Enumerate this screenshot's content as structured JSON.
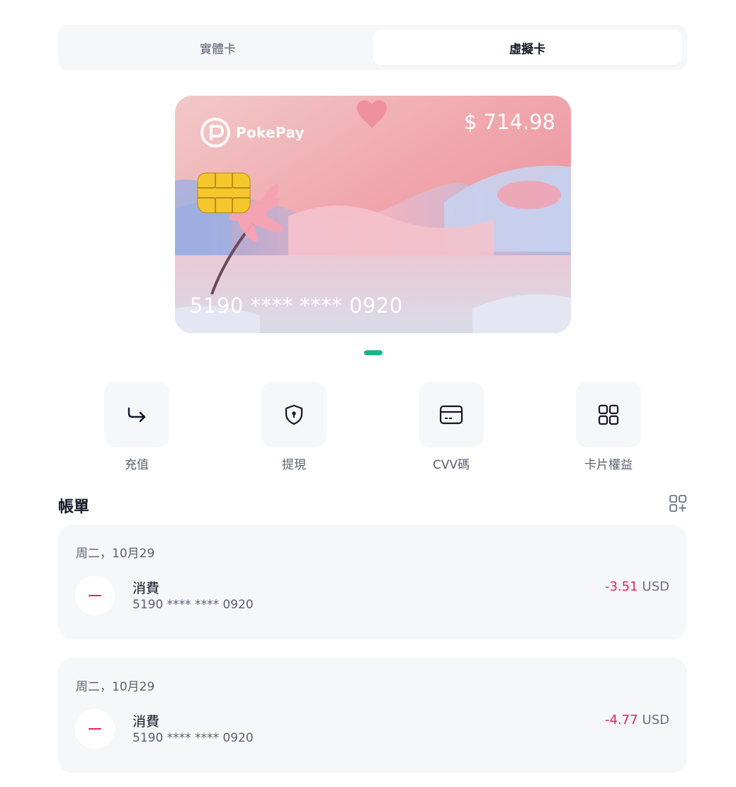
{
  "tabs": [
    {
      "label": "實體卡",
      "active": false
    },
    {
      "label": "虛擬卡",
      "active": true
    }
  ],
  "card": {
    "brand": "PokePay",
    "balance": "$ 714.98",
    "number": "5190 **** **** 0920"
  },
  "actions": [
    {
      "label": "充值",
      "icon": "redirect-arrow-icon"
    },
    {
      "label": "提現",
      "icon": "shield-keyhole-icon"
    },
    {
      "label": "CVV碼",
      "icon": "credit-card-icon"
    },
    {
      "label": "卡片權益",
      "icon": "grid-four-icon"
    }
  ],
  "bill": {
    "title": "帳單",
    "filter_icon": "grid-add-icon"
  },
  "transactions": [
    {
      "date": "周二，10月29",
      "title": "消費",
      "card_no": "5190 **** **** 0920",
      "amount": "-3.51",
      "currency": "USD"
    },
    {
      "date": "周二，10月29",
      "title": "消費",
      "card_no": "5190 **** **** 0920",
      "amount": "-4.77",
      "currency": "USD"
    }
  ],
  "colors": {
    "accent": "#17b584",
    "negative": "#e0245e",
    "panel": "#f6f7f9"
  }
}
